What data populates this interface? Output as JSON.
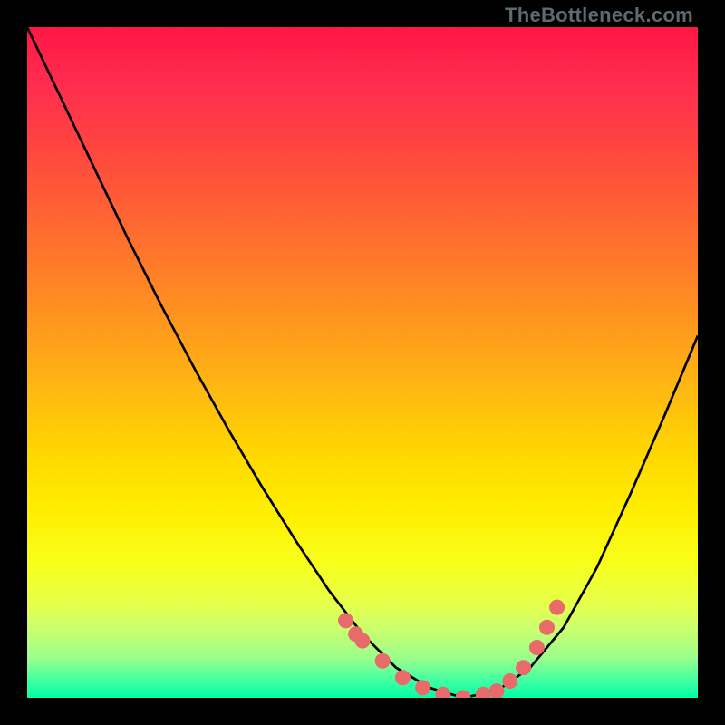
{
  "attribution": "TheBottleneck.com",
  "chart_data": {
    "type": "line",
    "title": "",
    "xlabel": "",
    "ylabel": "",
    "xlim": [
      0,
      1
    ],
    "ylim": [
      0,
      1
    ],
    "grid": false,
    "series": [
      {
        "name": "curve",
        "x": [
          0.0,
          0.05,
          0.1,
          0.15,
          0.2,
          0.25,
          0.3,
          0.35,
          0.4,
          0.45,
          0.5,
          0.55,
          0.6,
          0.65,
          0.7,
          0.75,
          0.8,
          0.85,
          0.9,
          0.95,
          1.0
        ],
        "y": [
          1.0,
          0.895,
          0.79,
          0.685,
          0.585,
          0.49,
          0.4,
          0.315,
          0.235,
          0.16,
          0.095,
          0.045,
          0.015,
          0.0,
          0.01,
          0.045,
          0.105,
          0.195,
          0.305,
          0.42,
          0.54
        ]
      }
    ],
    "highlight_points": {
      "name": "dots",
      "color": "#e96a6a",
      "x": [
        0.475,
        0.49,
        0.5,
        0.53,
        0.56,
        0.59,
        0.62,
        0.65,
        0.68,
        0.7,
        0.72,
        0.74,
        0.76,
        0.775,
        0.79
      ],
      "y": [
        0.115,
        0.095,
        0.085,
        0.055,
        0.03,
        0.015,
        0.005,
        0.0,
        0.005,
        0.01,
        0.025,
        0.045,
        0.075,
        0.105,
        0.135
      ]
    }
  }
}
